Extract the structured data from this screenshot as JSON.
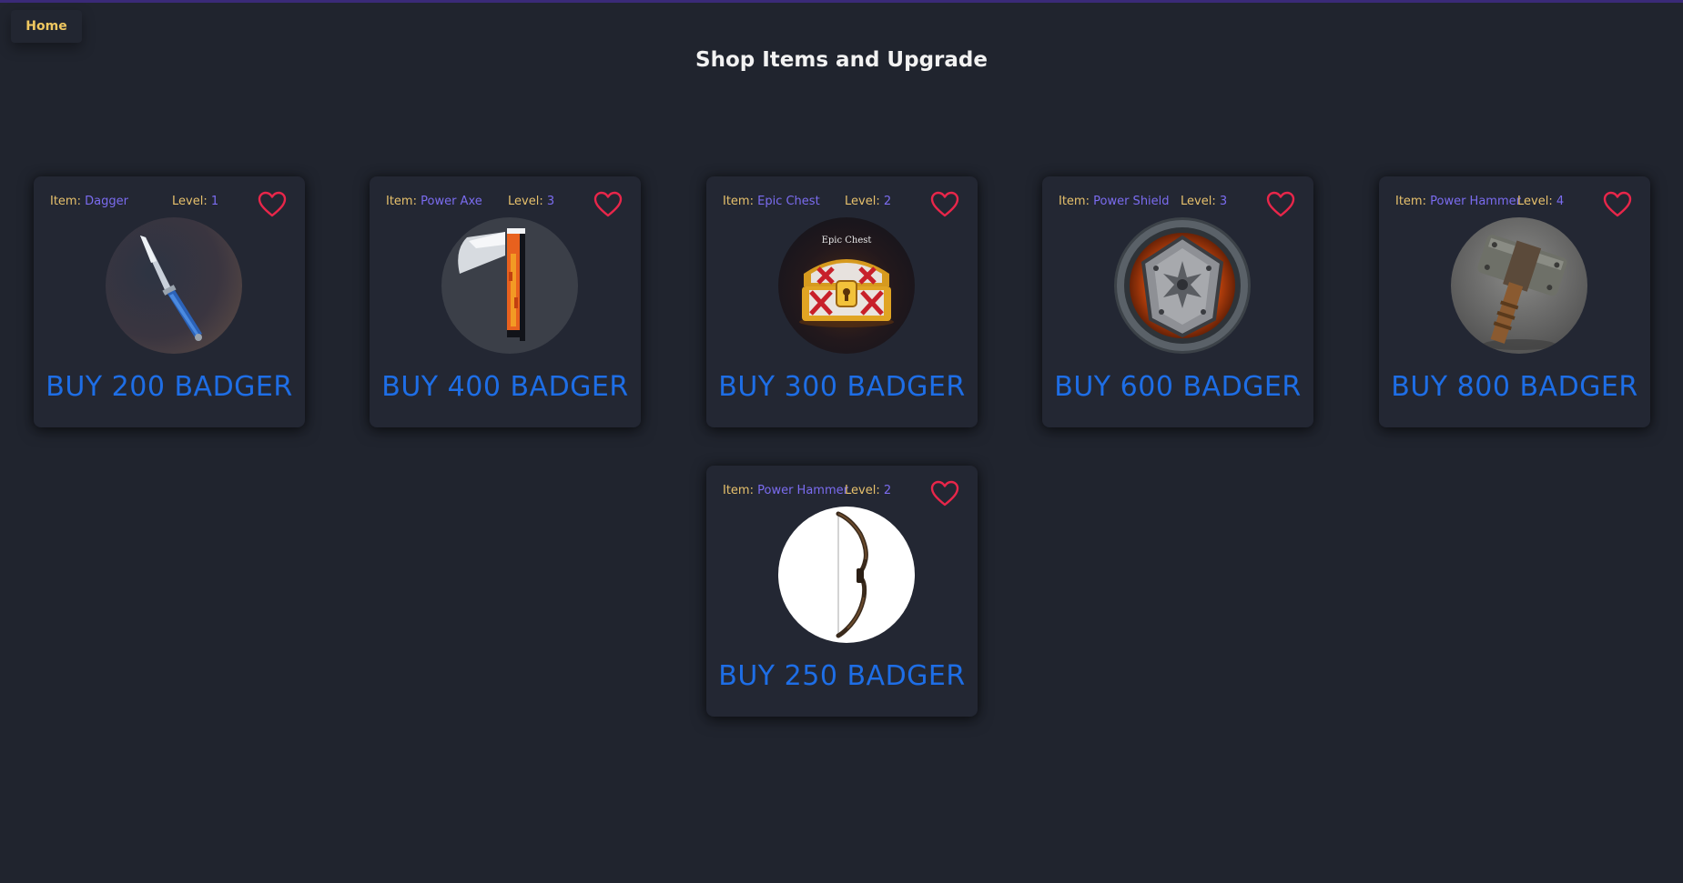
{
  "nav": {
    "home_label": "Home"
  },
  "page": {
    "title": "Shop Items and Upgrade"
  },
  "labels": {
    "item_prefix": "Item:",
    "level_prefix": "Level:"
  },
  "colors": {
    "background": "#20242e",
    "card": "#232733",
    "label": "#e7c16c",
    "value": "#7b6cf0",
    "buy": "#1e6ee6",
    "heart": "#e8264a",
    "home": "#f0c860"
  },
  "items": [
    {
      "name": "Dagger",
      "level": "1",
      "buy_label": "BUY 200 BADGER",
      "icon": "dagger-icon"
    },
    {
      "name": "Power Axe",
      "level": "3",
      "buy_label": "BUY 400 BADGER",
      "icon": "axe-icon"
    },
    {
      "name": "Epic Chest",
      "level": "2",
      "buy_label": "BUY 300 BADGER",
      "icon": "treasure-chest-icon",
      "image_caption": "Epic Chest"
    },
    {
      "name": "Power Shield",
      "level": "3",
      "buy_label": "BUY 600 BADGER",
      "icon": "shield-icon"
    },
    {
      "name": "Power Hammer",
      "level": "4",
      "buy_label": "BUY 800 BADGER",
      "icon": "hammer-icon"
    },
    {
      "name": "Power Hammer",
      "level": "2",
      "buy_label": "BUY 250 BADGER",
      "icon": "bow-icon"
    }
  ]
}
